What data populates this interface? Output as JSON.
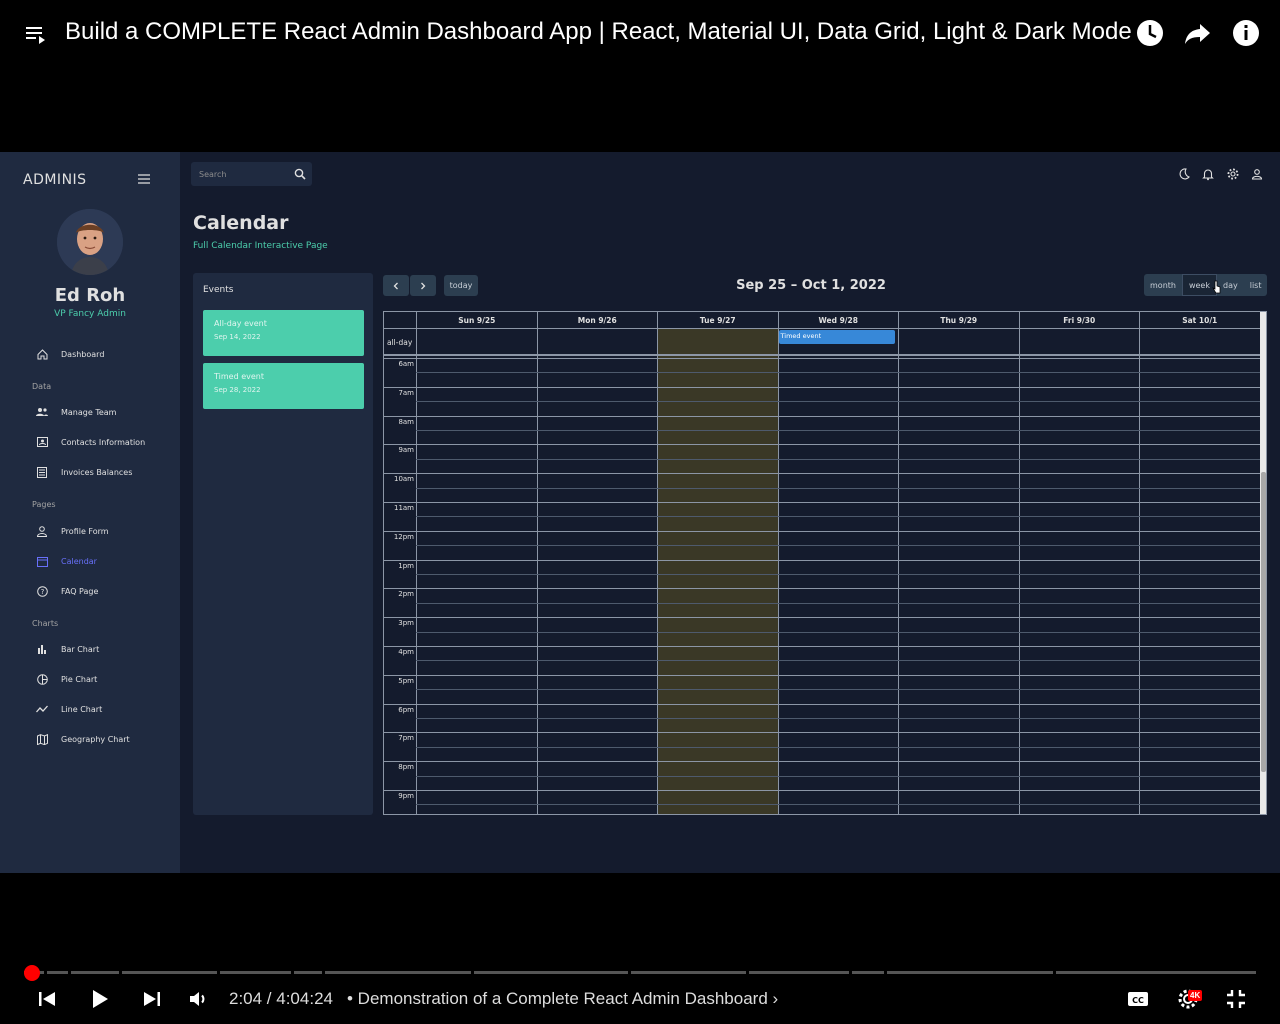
{
  "video": {
    "title": "Build a COMPLETE React Admin Dashboard App | React, Material UI, Data Grid, Light & Dark Mode",
    "time": "2:04 / 4:04:24",
    "chapter": "• Demonstration of a Complete React Admin Dashboard ›",
    "quality_badge": "4K"
  },
  "sidebar": {
    "brand": "ADMINIS",
    "user_name": "Ed Roh",
    "user_role": "VP Fancy Admin",
    "dashboard_label": "Dashboard",
    "sections": {
      "data": "Data",
      "pages": "Pages",
      "charts": "Charts"
    },
    "items": {
      "manage_team": "Manage Team",
      "contacts": "Contacts Information",
      "invoices": "Invoices Balances",
      "profile": "Profile Form",
      "calendar": "Calendar",
      "faq": "FAQ Page",
      "bar": "Bar Chart",
      "pie": "Pie Chart",
      "line": "Line Chart",
      "geo": "Geography Chart"
    }
  },
  "topbar": {
    "search_placeholder": "Search"
  },
  "page": {
    "title": "Calendar",
    "subtitle": "Full Calendar Interactive Page"
  },
  "events": {
    "title": "Events",
    "items": [
      {
        "title": "All-day event",
        "date": "Sep 14, 2022"
      },
      {
        "title": "Timed event",
        "date": "Sep 28, 2022"
      }
    ]
  },
  "calendar": {
    "title": "Sep 25 – Oct 1, 2022",
    "today_label": "today",
    "views": {
      "month": "month",
      "week": "week",
      "day": "day",
      "list": "list"
    },
    "active_view": "week",
    "days": [
      "Sun 9/25",
      "Mon 9/26",
      "Tue 9/27",
      "Wed 9/28",
      "Thu 9/29",
      "Fri 9/30",
      "Sat 10/1"
    ],
    "today_day": "Tue 9/27",
    "allday_label": "all-day",
    "times": [
      "6am",
      "7am",
      "8am",
      "9am",
      "10am",
      "11am",
      "12pm",
      "1pm",
      "2pm",
      "3pm",
      "4pm",
      "5pm",
      "6pm",
      "7pm",
      "8pm",
      "9pm"
    ],
    "allday_event": {
      "title": "Timed event",
      "day": "Wed 9/28"
    },
    "today_highlight_color": "#3a3826",
    "event_color": "#3788d8"
  },
  "colors": {
    "accent_green": "#4cceac",
    "active_nav": "#6870fa",
    "panel": "#1f2a40",
    "background": "#141b2d"
  }
}
